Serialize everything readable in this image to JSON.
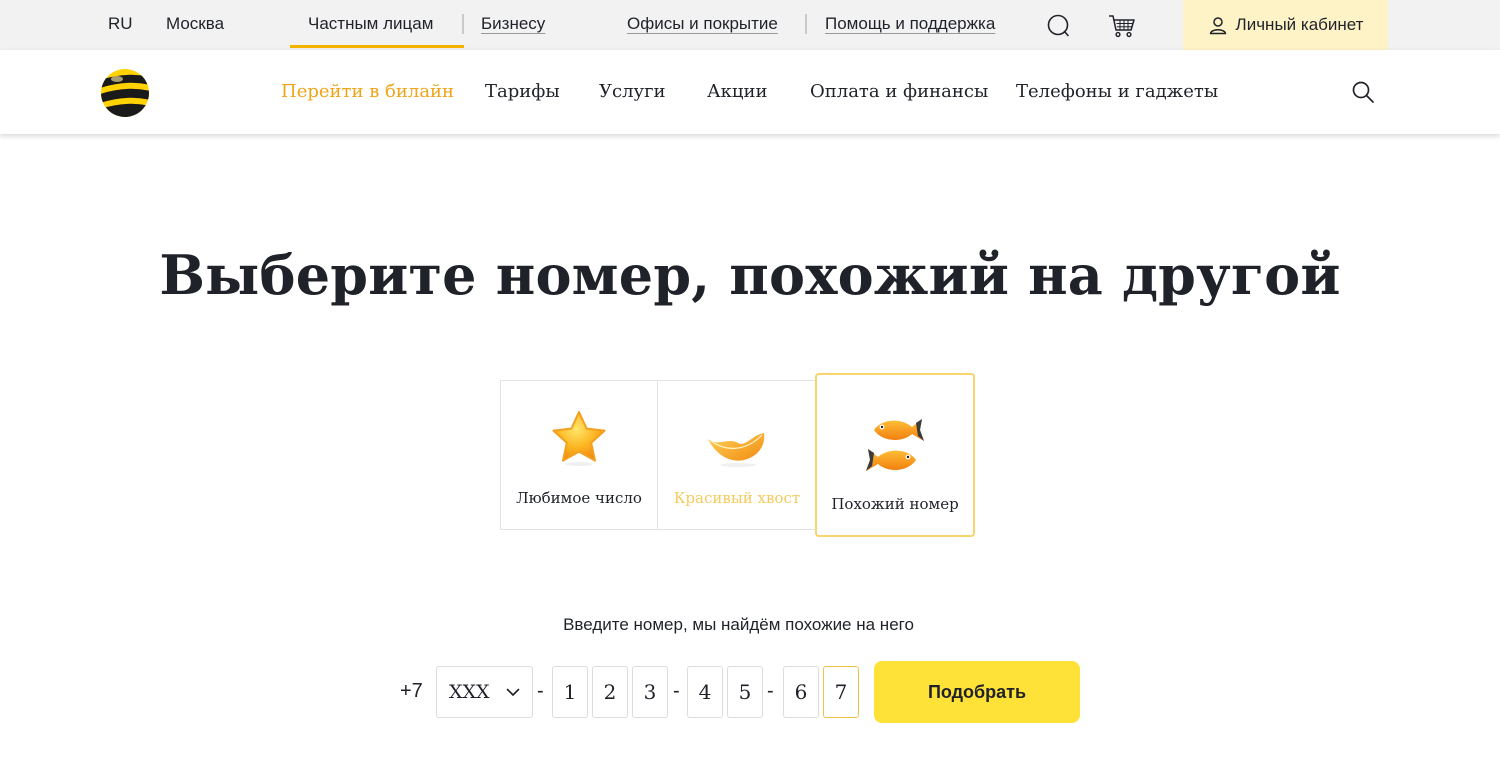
{
  "topbar": {
    "lang": "RU",
    "city": "Москва",
    "segments": [
      "Частным лицам",
      "Бизнесу"
    ],
    "links": [
      "Офисы и покрытие",
      "Помощь и поддержка"
    ],
    "cabinet": "Личный кабинет",
    "icons": [
      "chat-icon",
      "cart-icon",
      "user-icon"
    ]
  },
  "mainnav": {
    "items": [
      "Перейти в билайн",
      "Тарифы",
      "Услуги",
      "Акции",
      "Оплата и финансы",
      "Телефоны и гаджеты"
    ],
    "accent_color": "#f0a518",
    "icons": [
      "beeline-logo",
      "search-icon"
    ]
  },
  "heading": "Выберите номер, похожий на другой",
  "options": [
    {
      "label": "Любимое число",
      "icon": "star-icon",
      "state": "default"
    },
    {
      "label": "Красивый хвост",
      "icon": "feather-tail-icon",
      "state": "dimmed"
    },
    {
      "label": "Похожий номер",
      "icon": "fish-icon",
      "state": "selected"
    }
  ],
  "form": {
    "hint": "Введите номер, мы найдём похожие на него",
    "prefix": "+7",
    "code": "XXX",
    "separator": "-",
    "digits": [
      "1",
      "2",
      "3",
      "4",
      "5",
      "6",
      "7"
    ],
    "submit": "Подобрать"
  },
  "colors": {
    "brand_yellow": "#ffe238",
    "accent_orange": "#f0a518",
    "selected_border": "#f8d46c",
    "topbar_bg": "#f2f2f2",
    "cabinet_bg": "#fdf3c6"
  }
}
